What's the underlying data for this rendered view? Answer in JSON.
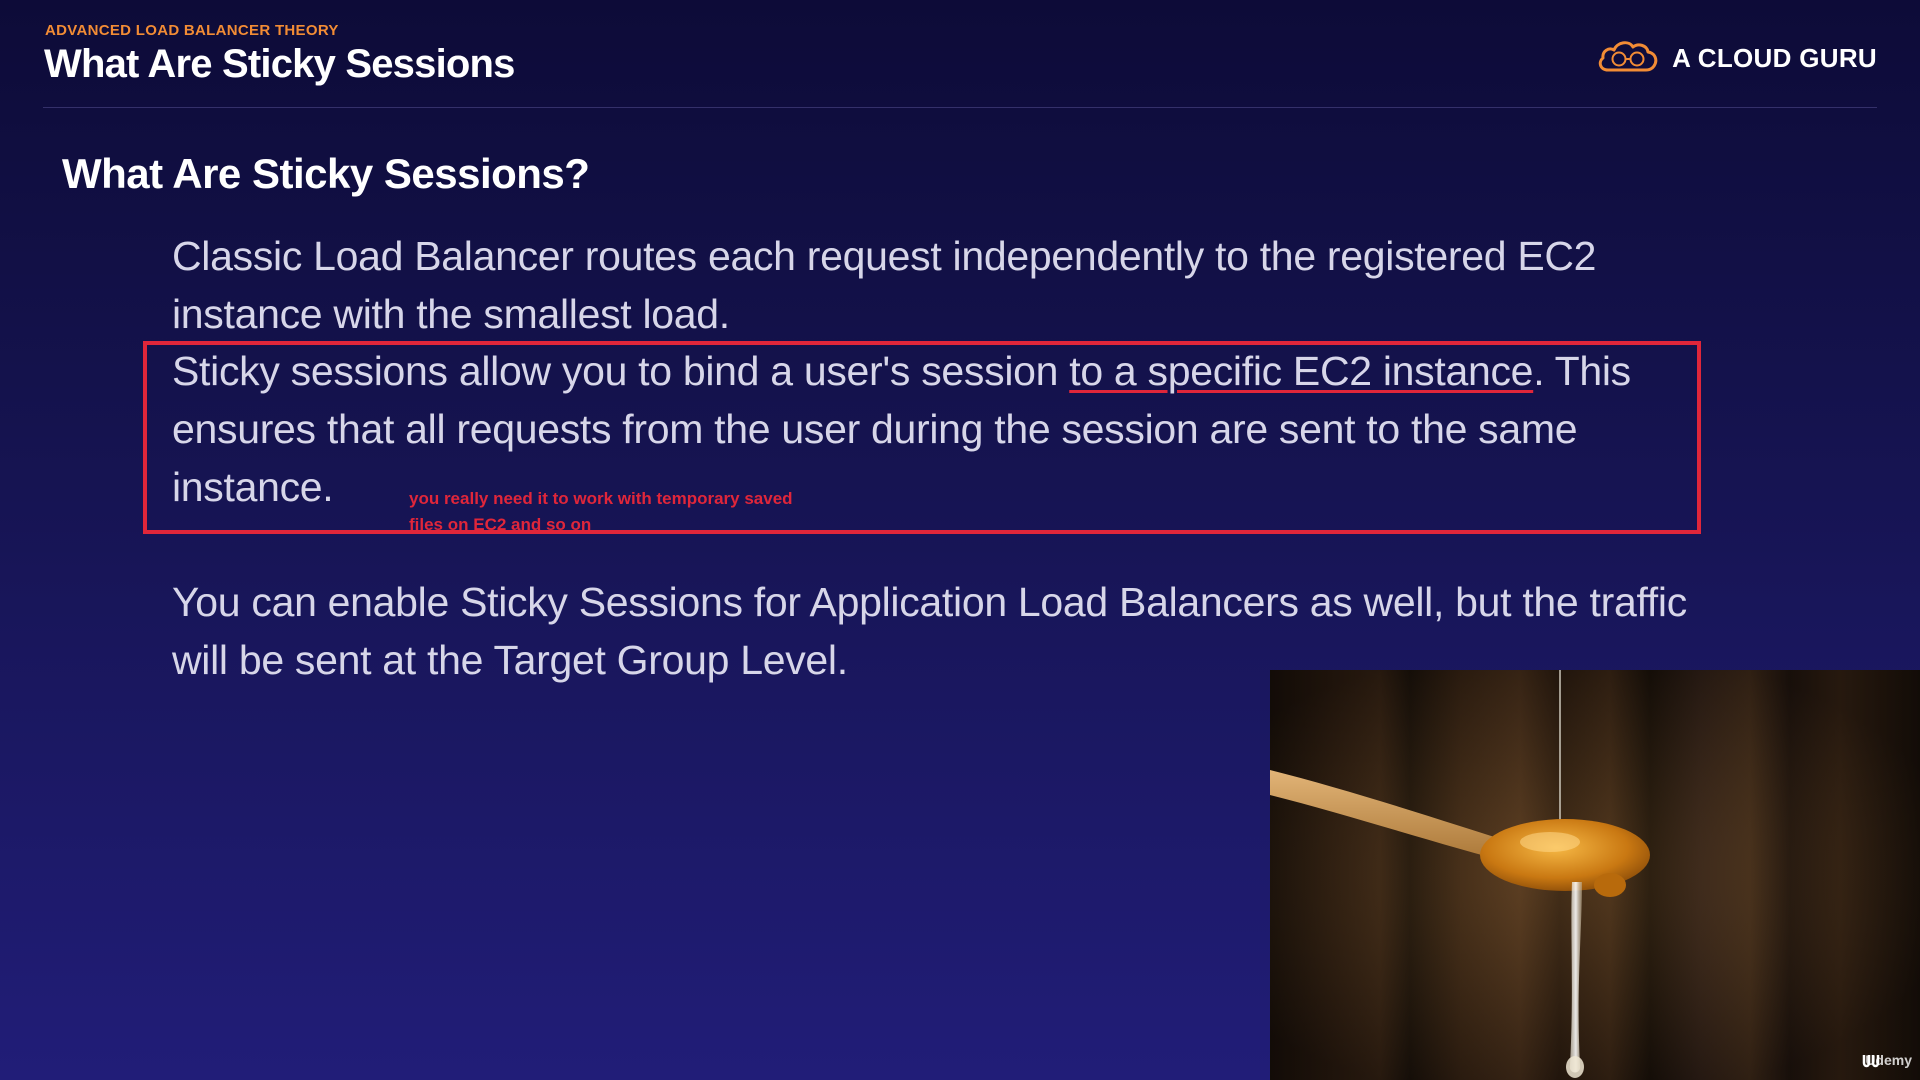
{
  "header": {
    "eyebrow": "ADVANCED LOAD BALANCER THEORY",
    "title": "What Are Sticky Sessions"
  },
  "brand": {
    "name": "A CLOUD GURU",
    "icon": "cloud-logo-icon",
    "accent_color": "#f28c35"
  },
  "slide": {
    "heading": "What Are Sticky Sessions?",
    "paragraph1": "Classic Load Balancer routes each request independently to the registered EC2 instance with the smallest load.",
    "paragraph2_before": "Sticky sessions allow you to bind a user's session ",
    "paragraph2_underlined": "to a specific EC2 instance",
    "paragraph2_after": ". This ensures that all requests from the user during the session are sent to the same instance.",
    "paragraph3": "You can enable Sticky Sessions for Application Load Balancers as well, but the traffic will be sent at the Target Group Level."
  },
  "annotation": {
    "text": "you really need it to work with temporary saved files on EC2 and so on",
    "color": "#e0263a"
  },
  "photo": {
    "subject": "honey dipper with dripping honey",
    "watermark": "Udemy"
  },
  "colors": {
    "background_top": "#0d0b38",
    "background_bottom": "#211d78",
    "highlight": "#e0263a"
  }
}
